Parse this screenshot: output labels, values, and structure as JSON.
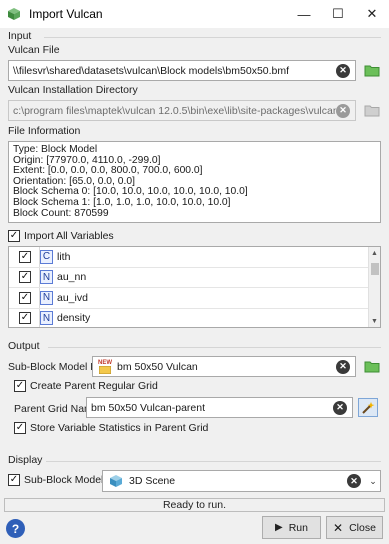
{
  "window": {
    "title": "Import Vulcan",
    "minimize": "—",
    "maximize": "☐",
    "close": "✕"
  },
  "input": {
    "section": "Input",
    "vulcan_file_label": "Vulcan File",
    "vulcan_file_value": "\\\\filesvr\\shared\\datasets\\vulcan\\Block models\\bm50x50.bmf",
    "install_dir_label": "Vulcan Installation Directory",
    "install_dir_value": "c:\\program files\\maptek\\vulcan 12.0.5\\bin\\exe\\lib\\site-packages\\vulcan",
    "file_info_label": "File Information",
    "file_info_text": "Type: Block Model\nOrigin: [77970.0, 4110.0, -299.0]\nExtent: [0.0, 0.0, 0.0, 800.0, 700.0, 600.0]\nOrientation: [65.0, 0.0, 0.0]\nBlock Schema 0: [10.0, 10.0, 10.0, 10.0, 10.0, 10.0]\nBlock Schema 1: [1.0, 1.0, 1.0, 10.0, 10.0, 10.0]\nBlock Count: 870599",
    "import_all_label": "Import All Variables",
    "import_all_checked": true,
    "variables": [
      {
        "type": "C",
        "name": "lith",
        "checked": true
      },
      {
        "type": "N",
        "name": "au_nn",
        "checked": true
      },
      {
        "type": "N",
        "name": "au_ivd",
        "checked": true
      },
      {
        "type": "N",
        "name": "density",
        "checked": true
      }
    ]
  },
  "output": {
    "section": "Output",
    "subblock_label": "Sub-Block Model File",
    "subblock_value": "bm 50x50 Vulcan",
    "new_badge": "NEW",
    "create_parent_label": "Create Parent Regular Grid",
    "create_parent_checked": true,
    "parent_grid_label": "Parent Grid Name",
    "parent_grid_value": "bm 50x50 Vulcan-parent",
    "store_stats_label": "Store Variable Statistics in Parent Grid",
    "store_stats_checked": true
  },
  "display": {
    "section": "Display",
    "subblock_in_label": "Sub-Block Model in",
    "subblock_in_checked": true,
    "scene_value": "3D Scene"
  },
  "status": "Ready to run.",
  "buttons": {
    "help": "?",
    "run": "Run",
    "close": "Close"
  },
  "icons": {
    "app": "vulcan-cube-icon",
    "clear": "clear-icon",
    "folder": "folder-icon",
    "wand": "magic-wand-icon",
    "scene": "3d-scene-icon",
    "run": "run-icon",
    "close": "close-icon",
    "help": "help-icon"
  },
  "colors": {
    "accent": "#2f5fb8",
    "folder_green": "#4caf50",
    "badge_blue": "#5b7bd5"
  }
}
